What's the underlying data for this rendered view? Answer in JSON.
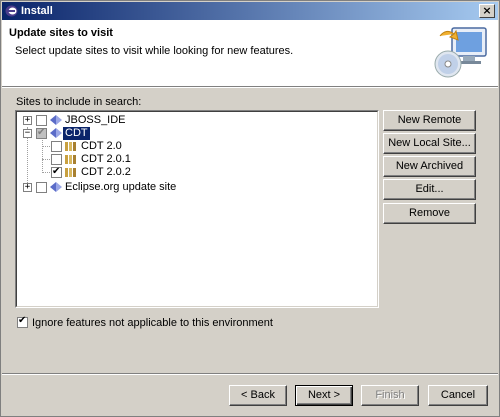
{
  "window": {
    "title": "Install"
  },
  "header": {
    "title": "Update sites to visit",
    "subtitle": "Select update sites to visit while looking for new features."
  },
  "sites_label": "Sites to include in search:",
  "tree": {
    "nodes": [
      {
        "label": "JBOSS_IDE",
        "checked": false,
        "expanded": false,
        "icon": "site-icon"
      },
      {
        "label": "CDT",
        "checked": "partial",
        "expanded": true,
        "selected": true,
        "icon": "site-icon",
        "children": [
          {
            "label": "CDT 2.0",
            "checked": false,
            "icon": "category-icon"
          },
          {
            "label": "CDT 2.0.1",
            "checked": false,
            "icon": "category-icon"
          },
          {
            "label": "CDT 2.0.2",
            "checked": true,
            "icon": "category-icon"
          }
        ]
      },
      {
        "label": "Eclipse.org update site",
        "checked": false,
        "expanded": false,
        "icon": "site-icon"
      }
    ]
  },
  "side_buttons": {
    "new_remote": "New Remote Site...",
    "new_local": "New Local Site...",
    "new_archived": "New Archived Site...",
    "edit": "Edit...",
    "remove": "Remove"
  },
  "ignore_checkbox": {
    "label": "Ignore features not applicable to this environment",
    "checked": true
  },
  "footer": {
    "back": "< Back",
    "next": "Next >",
    "finish": "Finish",
    "cancel": "Cancel"
  },
  "colors": {
    "title_start": "#0a246a",
    "title_end": "#a6caf0",
    "face": "#d4d0c8",
    "selection": "#0a246a"
  }
}
